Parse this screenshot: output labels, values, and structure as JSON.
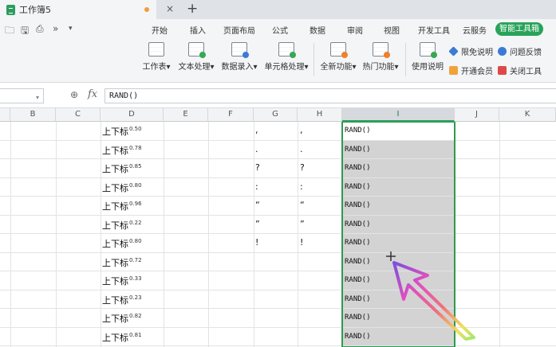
{
  "window": {
    "tab_title": "工作簿5",
    "close_glyph": "×",
    "new_tab_glyph": "+"
  },
  "quick_access": [
    "folder-icon",
    "save-icon",
    "print-icon",
    "more-icon",
    "dropdown-icon"
  ],
  "menu": {
    "items": [
      "开始",
      "插入",
      "页面布局",
      "公式",
      "数据",
      "审阅",
      "视图",
      "开发工具",
      "云服务"
    ],
    "active": "智能工具箱"
  },
  "ribbon": {
    "buttons": [
      "工作表",
      "文本处理",
      "数据录入",
      "单元格处理",
      "全新功能",
      "热门功能",
      "使用说明"
    ],
    "side": [
      "限免说明",
      "问题反馈",
      "开通会员",
      "关闭工具"
    ]
  },
  "formula_bar": {
    "name_box": "",
    "fx": "fx",
    "formula": "RAND()"
  },
  "columns": [
    "B",
    "C",
    "D",
    "E",
    "F",
    "G",
    "H",
    "I",
    "J",
    "K"
  ],
  "selected_column": "I",
  "rows": [
    {
      "d": "上下标",
      "sup": "0.50",
      "g": ",",
      "h": ",",
      "i": "RAND()"
    },
    {
      "d": "上下标",
      "sup": "0.78",
      "g": ".",
      "h": ".",
      "i": "RAND()"
    },
    {
      "d": "上下标",
      "sup": "0.85",
      "g": "?",
      "h": "?",
      "i": "RAND()"
    },
    {
      "d": "上下标",
      "sup": "0.80",
      "g": ":",
      "h": ":",
      "i": "RAND()"
    },
    {
      "d": "上下标",
      "sup": "0.96",
      "g": "“",
      "h": "“",
      "i": "RAND()"
    },
    {
      "d": "上下标",
      "sup": "0.22",
      "g": "”",
      "h": "”",
      "i": "RAND()"
    },
    {
      "d": "上下标",
      "sup": "0.80",
      "g": "!",
      "h": "!",
      "i": "RAND()"
    },
    {
      "d": "上下标",
      "sup": "0.72",
      "g": "",
      "h": "",
      "i": "RAND()"
    },
    {
      "d": "上下标",
      "sup": "0.33",
      "g": "",
      "h": "",
      "i": "RAND()"
    },
    {
      "d": "上下标",
      "sup": "0.23",
      "g": "",
      "h": "",
      "i": "RAND()"
    },
    {
      "d": "上下标",
      "sup": "0.82",
      "g": "",
      "h": "",
      "i": "RAND()"
    },
    {
      "d": "上下标",
      "sup": "0.81",
      "g": "",
      "h": "",
      "i": "RAND()"
    }
  ],
  "colors": {
    "accent": "#29a35a",
    "selection_border": "#2f9a4d",
    "selection_fill": "#d3d3d3"
  }
}
